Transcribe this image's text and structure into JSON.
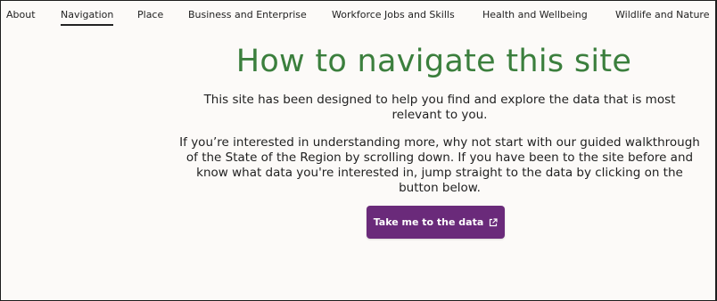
{
  "nav": {
    "items": [
      {
        "label": "About"
      },
      {
        "label": "Navigation",
        "active": true
      },
      {
        "label": "Place"
      },
      {
        "label": "Business and Enterprise"
      },
      {
        "label": "Workforce Jobs and Skills"
      },
      {
        "label": "Health and Wellbeing"
      },
      {
        "label": "Wildlife and Nature"
      }
    ]
  },
  "main": {
    "title": "How to navigate this site",
    "intro": "This site has been designed to help you find and explore the data that is most relevant to you.",
    "guide": "If you’re interested in understanding more, why not start with our guided walkthrough of the State of the Region by scrolling down. If you have been to the site before and know what data you're interested in, jump straight to the data by clicking on the button below.",
    "cta_label": "Take me to the data",
    "cta_icon": "external-link-icon"
  },
  "colors": {
    "title": "#3b7f3d",
    "button": "#6a2a7a",
    "background": "#fcfaf8",
    "text": "#1f1f1f"
  }
}
